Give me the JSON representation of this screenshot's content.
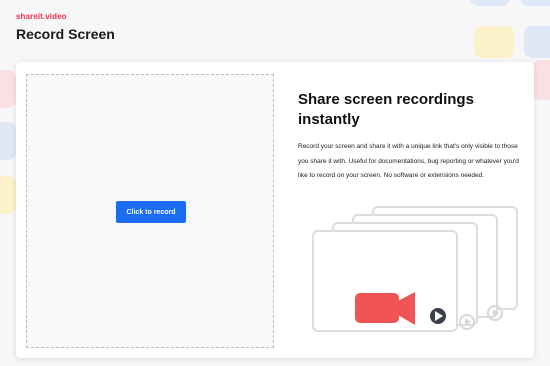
{
  "brand": {
    "logo_text": "shareit.video"
  },
  "page": {
    "title": "Record Screen"
  },
  "recorder": {
    "button_label": "Click to record"
  },
  "info": {
    "headline": "Share screen recordings instantly",
    "description": "Record your screen and share it with a unique link that's only visible to those you share it with. Useful for documentations, bug reporting or whatever you'd like to record on your screen. No software or extensions needed."
  },
  "colors": {
    "brand_red": "#e8324a",
    "button_blue": "#1a6cf3",
    "camera_red": "#f05454",
    "play_dark": "#3a3f4b"
  },
  "icons": [
    "video-camera-icon",
    "play-icon"
  ]
}
